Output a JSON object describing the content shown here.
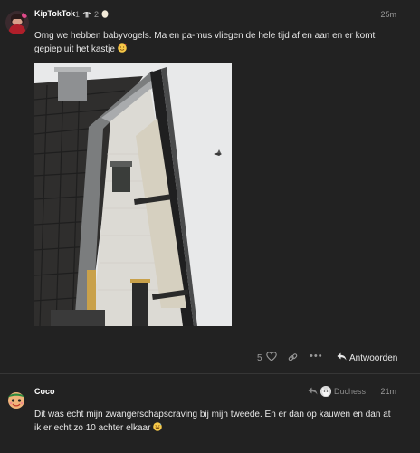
{
  "post1": {
    "username": "KipTokTok",
    "badges": [
      "1",
      "2"
    ],
    "timestamp": "25m",
    "body": "Omg we hebben babyvogels. Ma en pa-mus vliegen de hele tijd af en aan en er komt gepiep uit het kastje",
    "like_count": "5",
    "reply_label": "Antwoorden"
  },
  "post2": {
    "username": "Coco",
    "reply_to": "Duchess",
    "timestamp": "21m",
    "body": "Dit was echt mijn zwangerschapscraving bij mijn tweede. En er dan op kauwen en dan at ik er echt zo 10 achter elkaar"
  },
  "icons": {
    "like": "heart-icon",
    "link": "link-icon",
    "more": "more-icon",
    "reply": "reply-arrow-icon",
    "reply_to": "reply-to-arrow-icon"
  }
}
